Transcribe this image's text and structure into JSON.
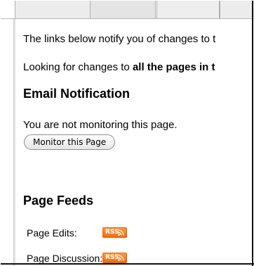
{
  "intro": {
    "line1": "The links below notify you of changes to t",
    "line2_prefix": "Looking for changes to ",
    "line2_bold": "all the pages in t"
  },
  "email": {
    "heading": "Email Notification",
    "status": "You are not monitoring this page.",
    "button_label": "Monitor this Page"
  },
  "feeds": {
    "heading": "Page Feeds",
    "items": [
      {
        "label": "Page Edits:",
        "badge": "RSS"
      },
      {
        "label": "Page Discussion:",
        "badge": "RSS"
      }
    ]
  },
  "colors": {
    "rss_orange": "#f26a10",
    "tab_gray": "#ececec"
  },
  "icons": {
    "feed": "rss-feed-icon"
  }
}
